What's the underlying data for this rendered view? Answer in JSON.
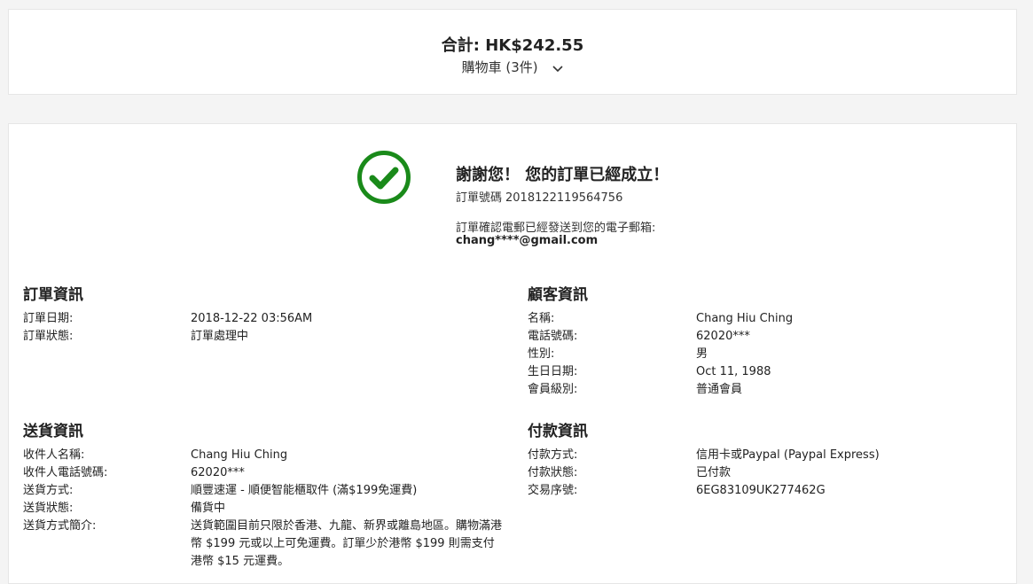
{
  "summary": {
    "total_label": "合計:",
    "total_value": "HK$242.55",
    "cart_label": "購物車 (3件)"
  },
  "confirmation": {
    "title": "謝謝您！ 您的訂單已經成立！",
    "order_no_label": "訂單號碼",
    "order_no": "2018122119564756",
    "email_note": "訂單確認電郵已經發送到您的電子郵箱:",
    "email": "chang****@gmail.com"
  },
  "order_info": {
    "title": "訂單資訊",
    "rows": [
      {
        "label": "訂單日期:",
        "value": "2018-12-22 03:56AM"
      },
      {
        "label": "訂單狀態:",
        "value": "訂單處理中"
      }
    ]
  },
  "customer_info": {
    "title": "顧客資訊",
    "rows": [
      {
        "label": "名稱:",
        "value": "Chang Hiu Ching"
      },
      {
        "label": "電話號碼:",
        "value": "62020***"
      },
      {
        "label": "性別:",
        "value": "男"
      },
      {
        "label": "生日日期:",
        "value": "Oct 11, 1988"
      },
      {
        "label": "會員級別:",
        "value": "普通會員"
      }
    ]
  },
  "delivery_info": {
    "title": "送貨資訊",
    "rows": [
      {
        "label": "收件人名稱:",
        "value": "Chang Hiu Ching"
      },
      {
        "label": "收件人電話號碼:",
        "value": "62020***"
      },
      {
        "label": "送貨方式:",
        "value": "順豐速運 - 順便智能櫃取件 (滿$199免運費)"
      },
      {
        "label": "送貨狀態:",
        "value": "備貨中"
      },
      {
        "label": "送貨方式簡介:",
        "value": "送貨範圍目前只限於香港、九龍、新界或離島地區。購物滿港幣 $199 元或以上可免運費。訂單少於港幣 $199 則需支付港幣 $15 元運費。"
      }
    ]
  },
  "payment_info": {
    "title": "付款資訊",
    "rows": [
      {
        "label": "付款方式:",
        "value": "信用卡或Paypal (Paypal Express)"
      },
      {
        "label": "付款狀態:",
        "value": "已付款"
      },
      {
        "label": "交易序號:",
        "value": "6EG83109UK277462G"
      }
    ]
  },
  "colors": {
    "check": "#1a8a1a"
  },
  "icons": {
    "check": "check-circle-icon",
    "chevron": "chevron-down-icon"
  }
}
